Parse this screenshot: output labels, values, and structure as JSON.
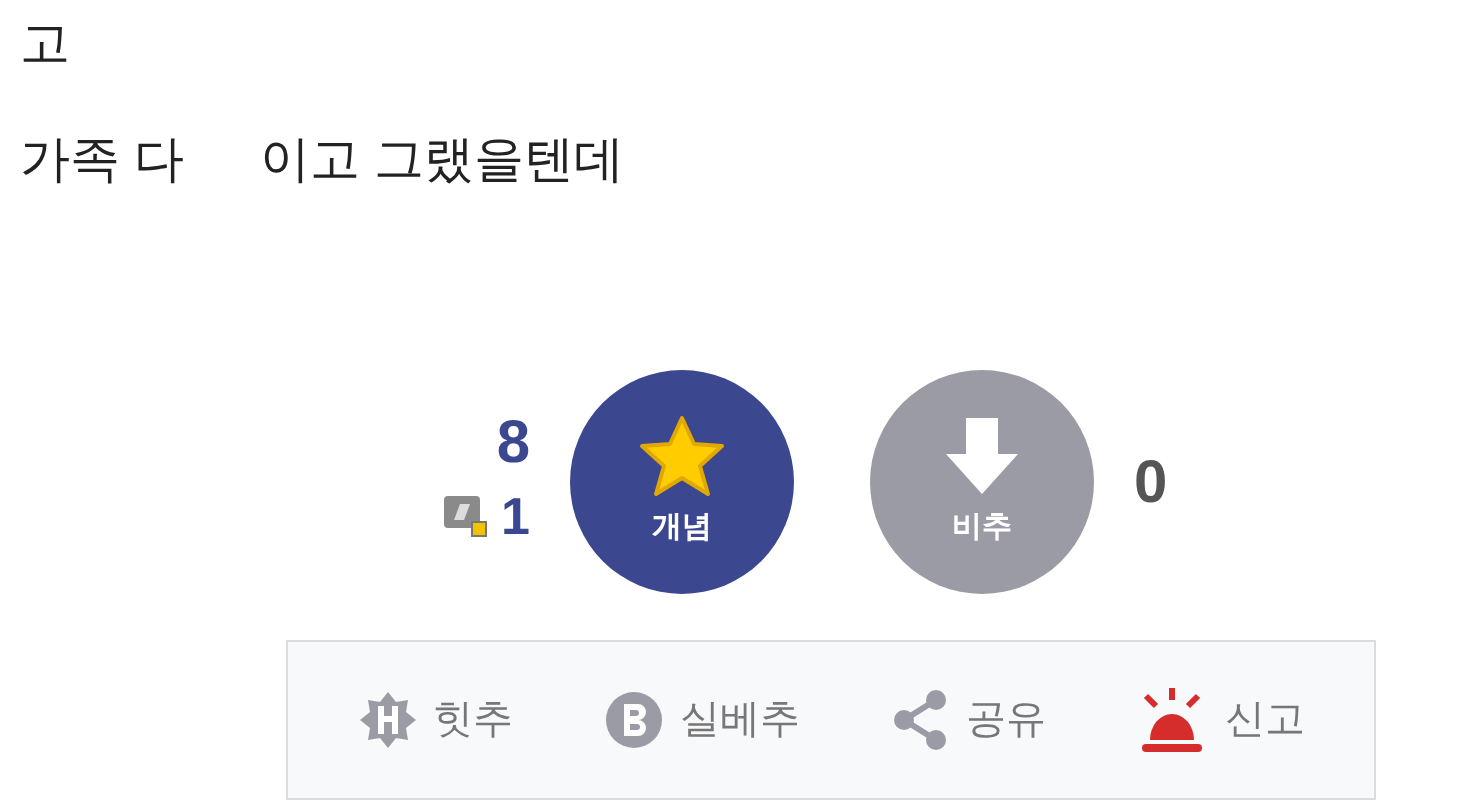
{
  "post": {
    "lines": [
      [
        "고"
      ],
      [
        "가족 다",
        "이고 그랬을텐데"
      ]
    ]
  },
  "vote": {
    "up_count": "8",
    "fixed_count": "1",
    "up_label": "개념",
    "down_label": "비추",
    "down_count": "0"
  },
  "actions": [
    {
      "kind": "hit",
      "label": "힛추"
    },
    {
      "kind": "best",
      "label": "실베추"
    },
    {
      "kind": "share",
      "label": "공유"
    },
    {
      "kind": "report",
      "label": "신고"
    }
  ]
}
